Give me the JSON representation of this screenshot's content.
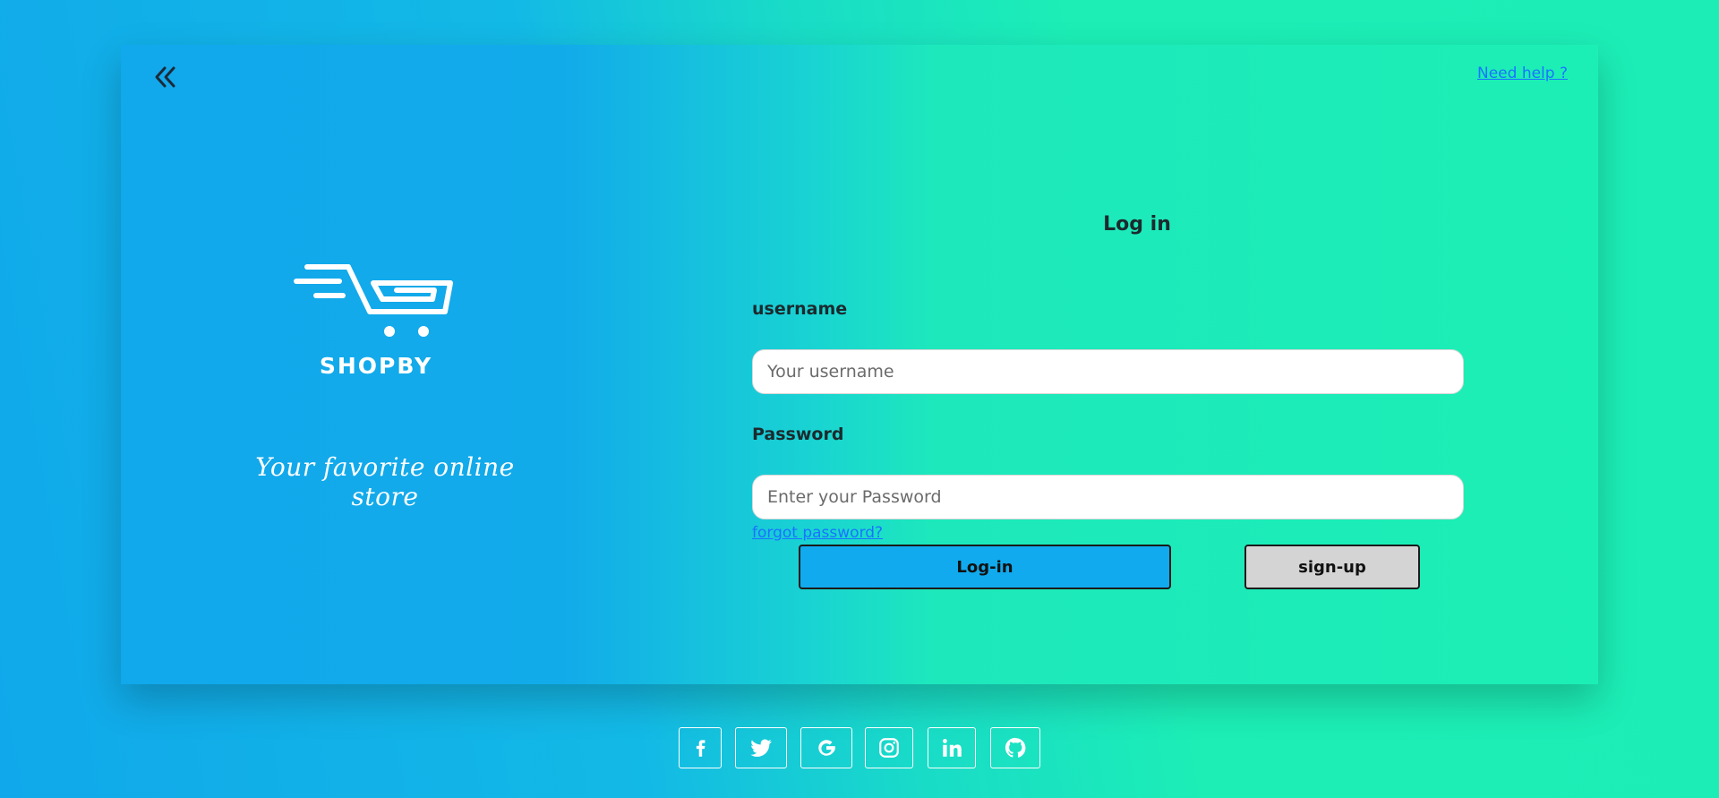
{
  "header": {
    "back_icon": "double-chevron-left-icon",
    "help_link": "Need help ?"
  },
  "brand": {
    "logo_icon": "shopping-cart-icon",
    "name": "SHOPBY",
    "tagline": "Your favorite online store"
  },
  "form": {
    "title": "Log in",
    "username_label": "username",
    "username_placeholder": "Your username",
    "password_label": "Password",
    "password_placeholder": "Enter your Password",
    "forgot_link": "forgot password?",
    "login_button": "Log-in",
    "signup_button": "sign-up"
  },
  "social": [
    {
      "icon": "facebook-icon"
    },
    {
      "icon": "twitter-icon"
    },
    {
      "icon": "google-icon"
    },
    {
      "icon": "instagram-icon"
    },
    {
      "icon": "linkedin-icon"
    },
    {
      "icon": "github-icon"
    }
  ],
  "colors": {
    "login_button": "#11aaee",
    "signup_button": "#d4d4d4",
    "link": "#1a73ff"
  }
}
